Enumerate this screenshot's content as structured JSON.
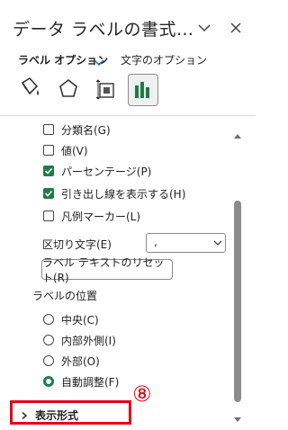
{
  "pane": {
    "title": "データ ラベルの書式…",
    "tabs": [
      {
        "label": "ラベル オプション"
      },
      {
        "label": "文字のオプション"
      }
    ]
  },
  "options": {
    "checkboxes": [
      {
        "label": "分類名(G)",
        "checked": false
      },
      {
        "label": "値(V)",
        "checked": false
      },
      {
        "label": "パーセンテージ(P)",
        "checked": true
      },
      {
        "label": "引き出し線を表示する(H)",
        "checked": true
      },
      {
        "label": "凡例マーカー(L)",
        "checked": false
      }
    ],
    "separator_label": "区切り文字(E)",
    "separator_value": ",",
    "reset_button": "ラベル テキストのリセット(R)",
    "position_heading": "ラベルの位置",
    "positions": [
      {
        "label": "中央(C)",
        "selected": false
      },
      {
        "label": "内部外側(I)",
        "selected": false
      },
      {
        "label": "外部(O)",
        "selected": false
      },
      {
        "label": "自動調整(F)",
        "selected": true
      }
    ],
    "collapsed_section": "表示形式"
  },
  "annotation": {
    "marker": "⑧"
  },
  "colors": {
    "accent": "#1e7d46",
    "highlight": "#e60012"
  }
}
